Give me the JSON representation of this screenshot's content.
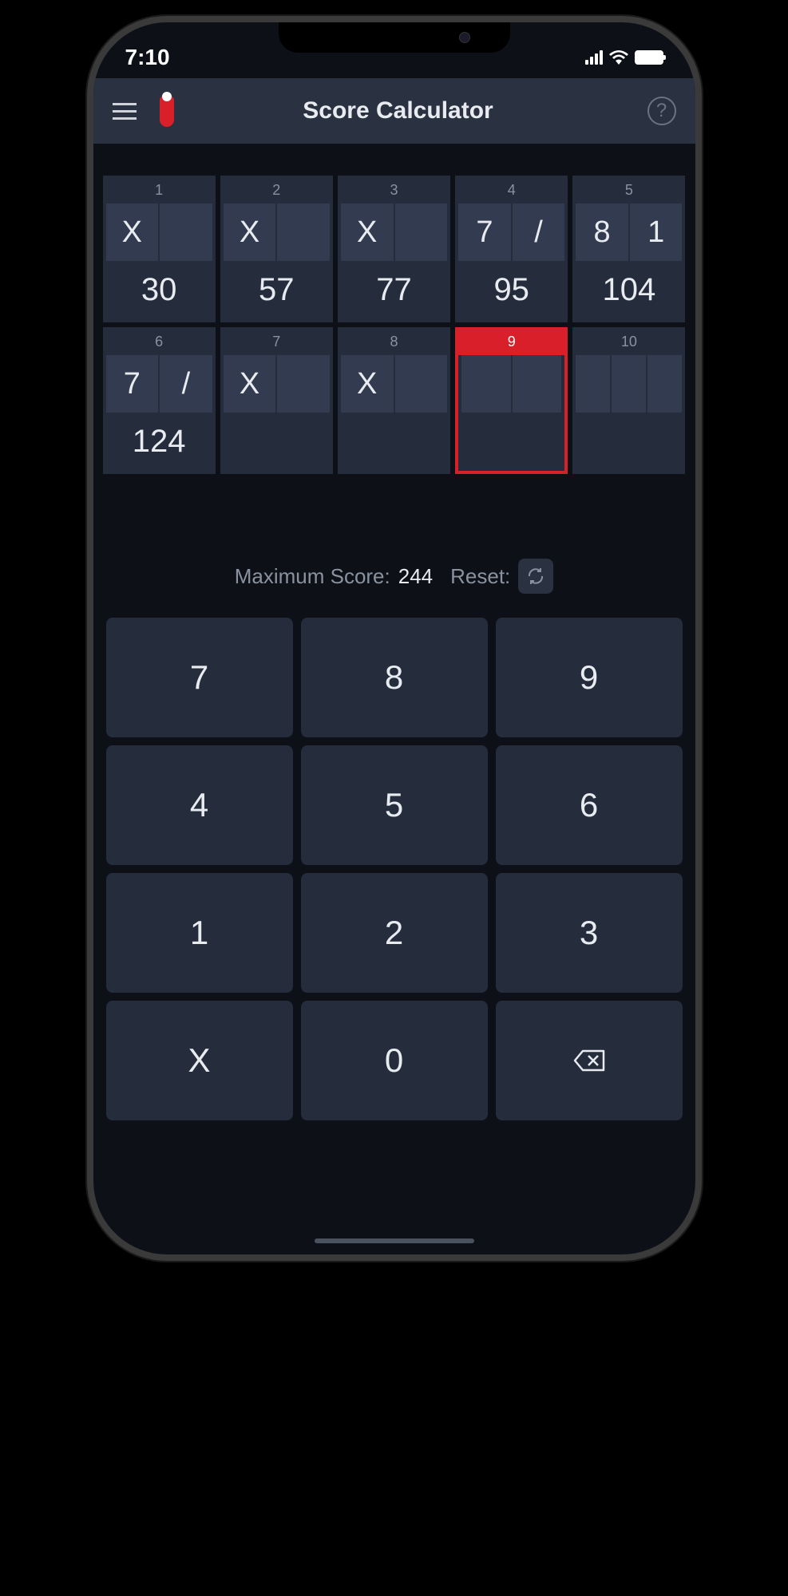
{
  "status": {
    "time": "7:10"
  },
  "header": {
    "title": "Score Calculator"
  },
  "frames": [
    {
      "num": "1",
      "balls": [
        "X",
        ""
      ],
      "score": "30",
      "active": false,
      "extra": false
    },
    {
      "num": "2",
      "balls": [
        "X",
        ""
      ],
      "score": "57",
      "active": false,
      "extra": false
    },
    {
      "num": "3",
      "balls": [
        "X",
        ""
      ],
      "score": "77",
      "active": false,
      "extra": false
    },
    {
      "num": "4",
      "balls": [
        "7",
        "/"
      ],
      "score": "95",
      "active": false,
      "extra": false
    },
    {
      "num": "5",
      "balls": [
        "8",
        "1"
      ],
      "score": "104",
      "active": false,
      "extra": false
    },
    {
      "num": "6",
      "balls": [
        "7",
        "/"
      ],
      "score": "124",
      "active": false,
      "extra": false
    },
    {
      "num": "7",
      "balls": [
        "X",
        ""
      ],
      "score": "",
      "active": false,
      "extra": false
    },
    {
      "num": "8",
      "balls": [
        "X",
        ""
      ],
      "score": "",
      "active": false,
      "extra": false
    },
    {
      "num": "9",
      "balls": [
        "",
        ""
      ],
      "score": "",
      "active": true,
      "extra": false
    },
    {
      "num": "10",
      "balls": [
        "",
        "",
        ""
      ],
      "score": "",
      "active": false,
      "extra": true
    }
  ],
  "info": {
    "max_label": "Maximum Score:",
    "max_value": "244",
    "reset_label": "Reset:"
  },
  "keypad": [
    "7",
    "8",
    "9",
    "4",
    "5",
    "6",
    "1",
    "2",
    "3",
    "X",
    "0",
    "⌫"
  ]
}
